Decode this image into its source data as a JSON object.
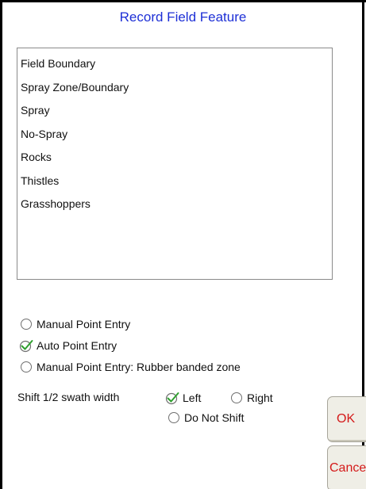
{
  "dialog": {
    "title": "Record Field Feature"
  },
  "feature_list": {
    "items": [
      "Field Boundary",
      "Spray Zone/Boundary",
      "Spray",
      "No-Spray",
      "Rocks",
      "Thistles",
      "Grasshoppers"
    ]
  },
  "entry_mode": {
    "options": [
      {
        "label": "Manual Point Entry",
        "checked": false
      },
      {
        "label": "Auto Point Entry",
        "checked": true
      },
      {
        "label": "Manual Point Entry: Rubber banded zone",
        "checked": false
      }
    ]
  },
  "shift": {
    "label": "Shift 1/2 swath width",
    "left_label": "Left",
    "right_label": "Right",
    "noshift_label": "Do Not Shift",
    "selected": "Left"
  },
  "buttons": {
    "ok_label": "OK",
    "cancel_label": "Cance"
  },
  "colors": {
    "title": "#1d2fd6",
    "button_text": "#d41a1a",
    "check": "#2e9f2e"
  },
  "icons": {
    "radio_selected": "check-radio-icon",
    "radio_unselected": "radio-empty-icon"
  }
}
